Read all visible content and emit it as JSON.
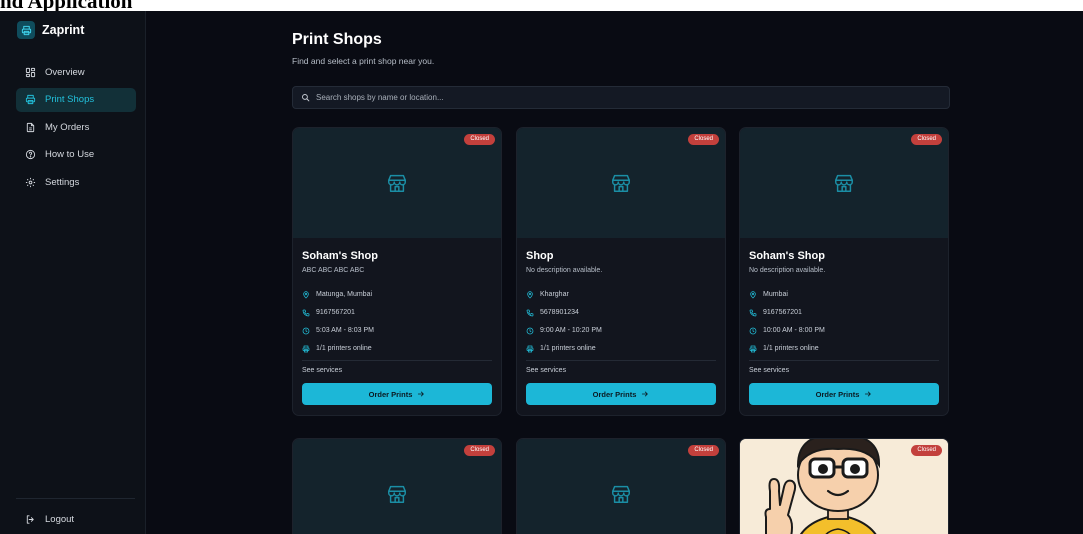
{
  "caption": "nd Application",
  "brand": {
    "name": "Zaprint"
  },
  "nav": [
    {
      "label": "Overview",
      "icon": "grid-icon",
      "active": false
    },
    {
      "label": "Print Shops",
      "icon": "printer-icon",
      "active": true
    },
    {
      "label": "My Orders",
      "icon": "document-icon",
      "active": false
    },
    {
      "label": "How to Use",
      "icon": "help-circle-icon",
      "active": false
    },
    {
      "label": "Settings",
      "icon": "gear-icon",
      "active": false
    }
  ],
  "logout_label": "Logout",
  "page": {
    "title": "Print Shops",
    "subtitle": "Find and select a print shop near you."
  },
  "search": {
    "placeholder": "Search shops by name or location..."
  },
  "shops": [
    {
      "name": "Soham's Shop",
      "description": "ABC ABC ABC ABC",
      "status": "Closed",
      "location": "Matunga, Mumbai",
      "phone": "9167567201",
      "hours": "5:03 AM - 8:03 PM",
      "printers": "1/1 printers online",
      "services_label": "See services",
      "order_label": "Order Prints"
    },
    {
      "name": "Shop",
      "description": "No description available.",
      "status": "Closed",
      "location": "Kharghar",
      "phone": "5678901234",
      "hours": "9:00 AM - 10:20 PM",
      "printers": "1/1 printers online",
      "services_label": "See services",
      "order_label": "Order Prints"
    },
    {
      "name": "Soham's Shop",
      "description": "No description available.",
      "status": "Closed",
      "location": "Mumbai",
      "phone": "9167567201",
      "hours": "10:00 AM - 8:00 PM",
      "printers": "1/1 printers online",
      "services_label": "See services",
      "order_label": "Order Prints"
    },
    {
      "status": "Closed"
    },
    {
      "status": "Closed"
    },
    {
      "status": "Closed"
    }
  ],
  "colors": {
    "accent": "#1cb7d7",
    "closed_badge": "#c3403c",
    "background": "#090b13"
  }
}
